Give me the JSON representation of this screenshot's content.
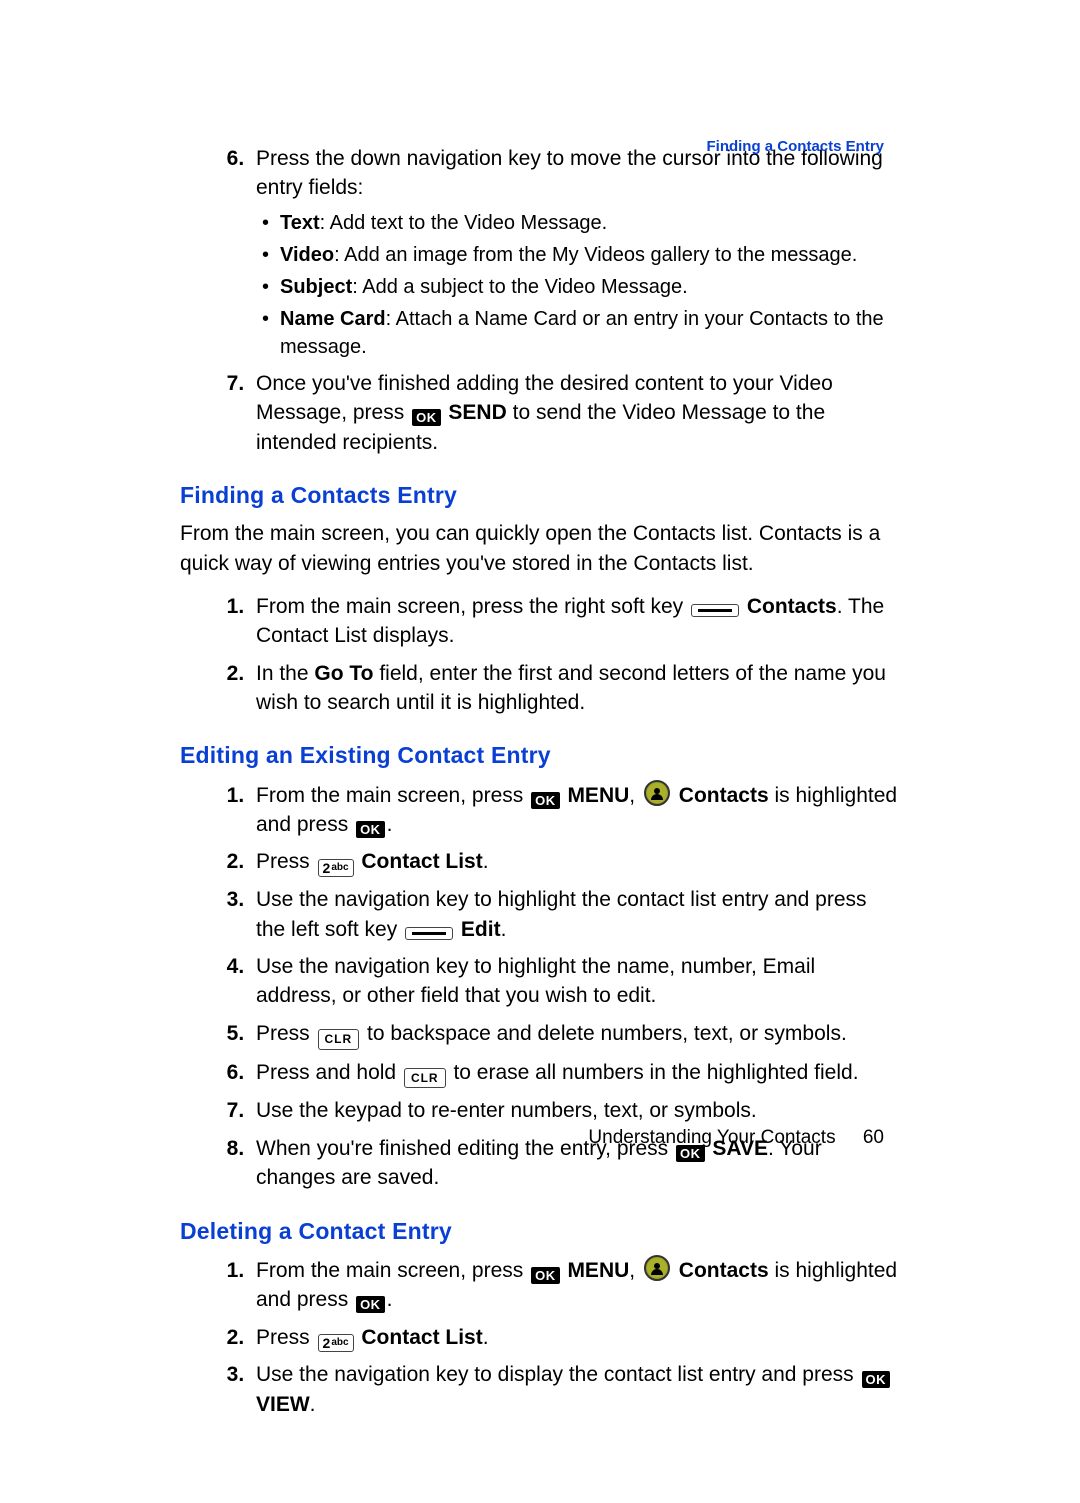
{
  "header": {
    "running_head": "Finding a Contacts Entry"
  },
  "icons": {
    "ok": "OK",
    "clr": "CLR",
    "two": "2",
    "abc": "abc"
  },
  "vm": {
    "step6_intro": "Press the down navigation key to move the cursor into the following entry fields:",
    "bullets": {
      "text_label": "Text",
      "text_rest": ": Add text to the Video Message.",
      "video_label": "Video",
      "video_rest": ": Add an image from the My Videos gallery to the message.",
      "subject_label": "Subject",
      "subject_rest": ": Add a subject to the Video Message.",
      "namecard_label": "Name Card",
      "namecard_rest": ": Attach a Name Card or an entry in your Contacts to the message."
    },
    "step7_a": "Once you've finished adding the desired content to your Video Message, press ",
    "step7_send": "SEND",
    "step7_b": " to send the Video Message to the intended recipients."
  },
  "finding": {
    "heading": "Finding a Contacts Entry",
    "intro": "From the main screen, you can quickly open the Contacts list. Contacts is a quick way of viewing entries you've stored in the Contacts list.",
    "s1_a": "From the main screen, press the right soft key ",
    "s1_contacts": "Contacts",
    "s1_b": ". The Contact List displays.",
    "s2_a": "In the ",
    "s2_goto": "Go To",
    "s2_b": " field, enter the first and second letters of the name you wish to search until it is highlighted."
  },
  "editing": {
    "heading": "Editing an Existing Contact Entry",
    "s1_a": "From the main screen, press ",
    "s1_menu": "MENU",
    "s1_b": ", ",
    "s1_contacts": "Contacts",
    "s1_c": " is highlighted and press ",
    "s1_d": ".",
    "s2_a": "Press ",
    "s2_cl": "Contact List",
    "s2_b": ".",
    "s3_a": "Use the navigation key to highlight the contact list entry and press the left soft key ",
    "s3_edit": "Edit",
    "s3_b": ".",
    "s4": "Use the navigation key to highlight the name, number, Email address, or other field that you wish to edit.",
    "s5_a": "Press ",
    "s5_b": " to backspace and delete numbers, text, or symbols.",
    "s6_a": "Press and hold ",
    "s6_b": " to erase all numbers in the highlighted field.",
    "s7": "Use the keypad to re-enter numbers, text, or symbols.",
    "s8_a": "When you're finished editing the entry, press ",
    "s8_save": "SAVE",
    "s8_b": ". Your changes are saved."
  },
  "deleting": {
    "heading": "Deleting a Contact Entry",
    "s1_a": "From the main screen, press ",
    "s1_menu": "MENU",
    "s1_b": ", ",
    "s1_contacts": "Contacts",
    "s1_c": " is highlighted and press ",
    "s1_d": ".",
    "s2_a": "Press ",
    "s2_cl": "Contact List",
    "s2_b": ".",
    "s3_a": "Use the navigation key to display the contact list entry and press ",
    "s3_view": "VIEW",
    "s3_b": "."
  },
  "footer": {
    "chapter": "Understanding Your Contacts",
    "page": "60"
  }
}
